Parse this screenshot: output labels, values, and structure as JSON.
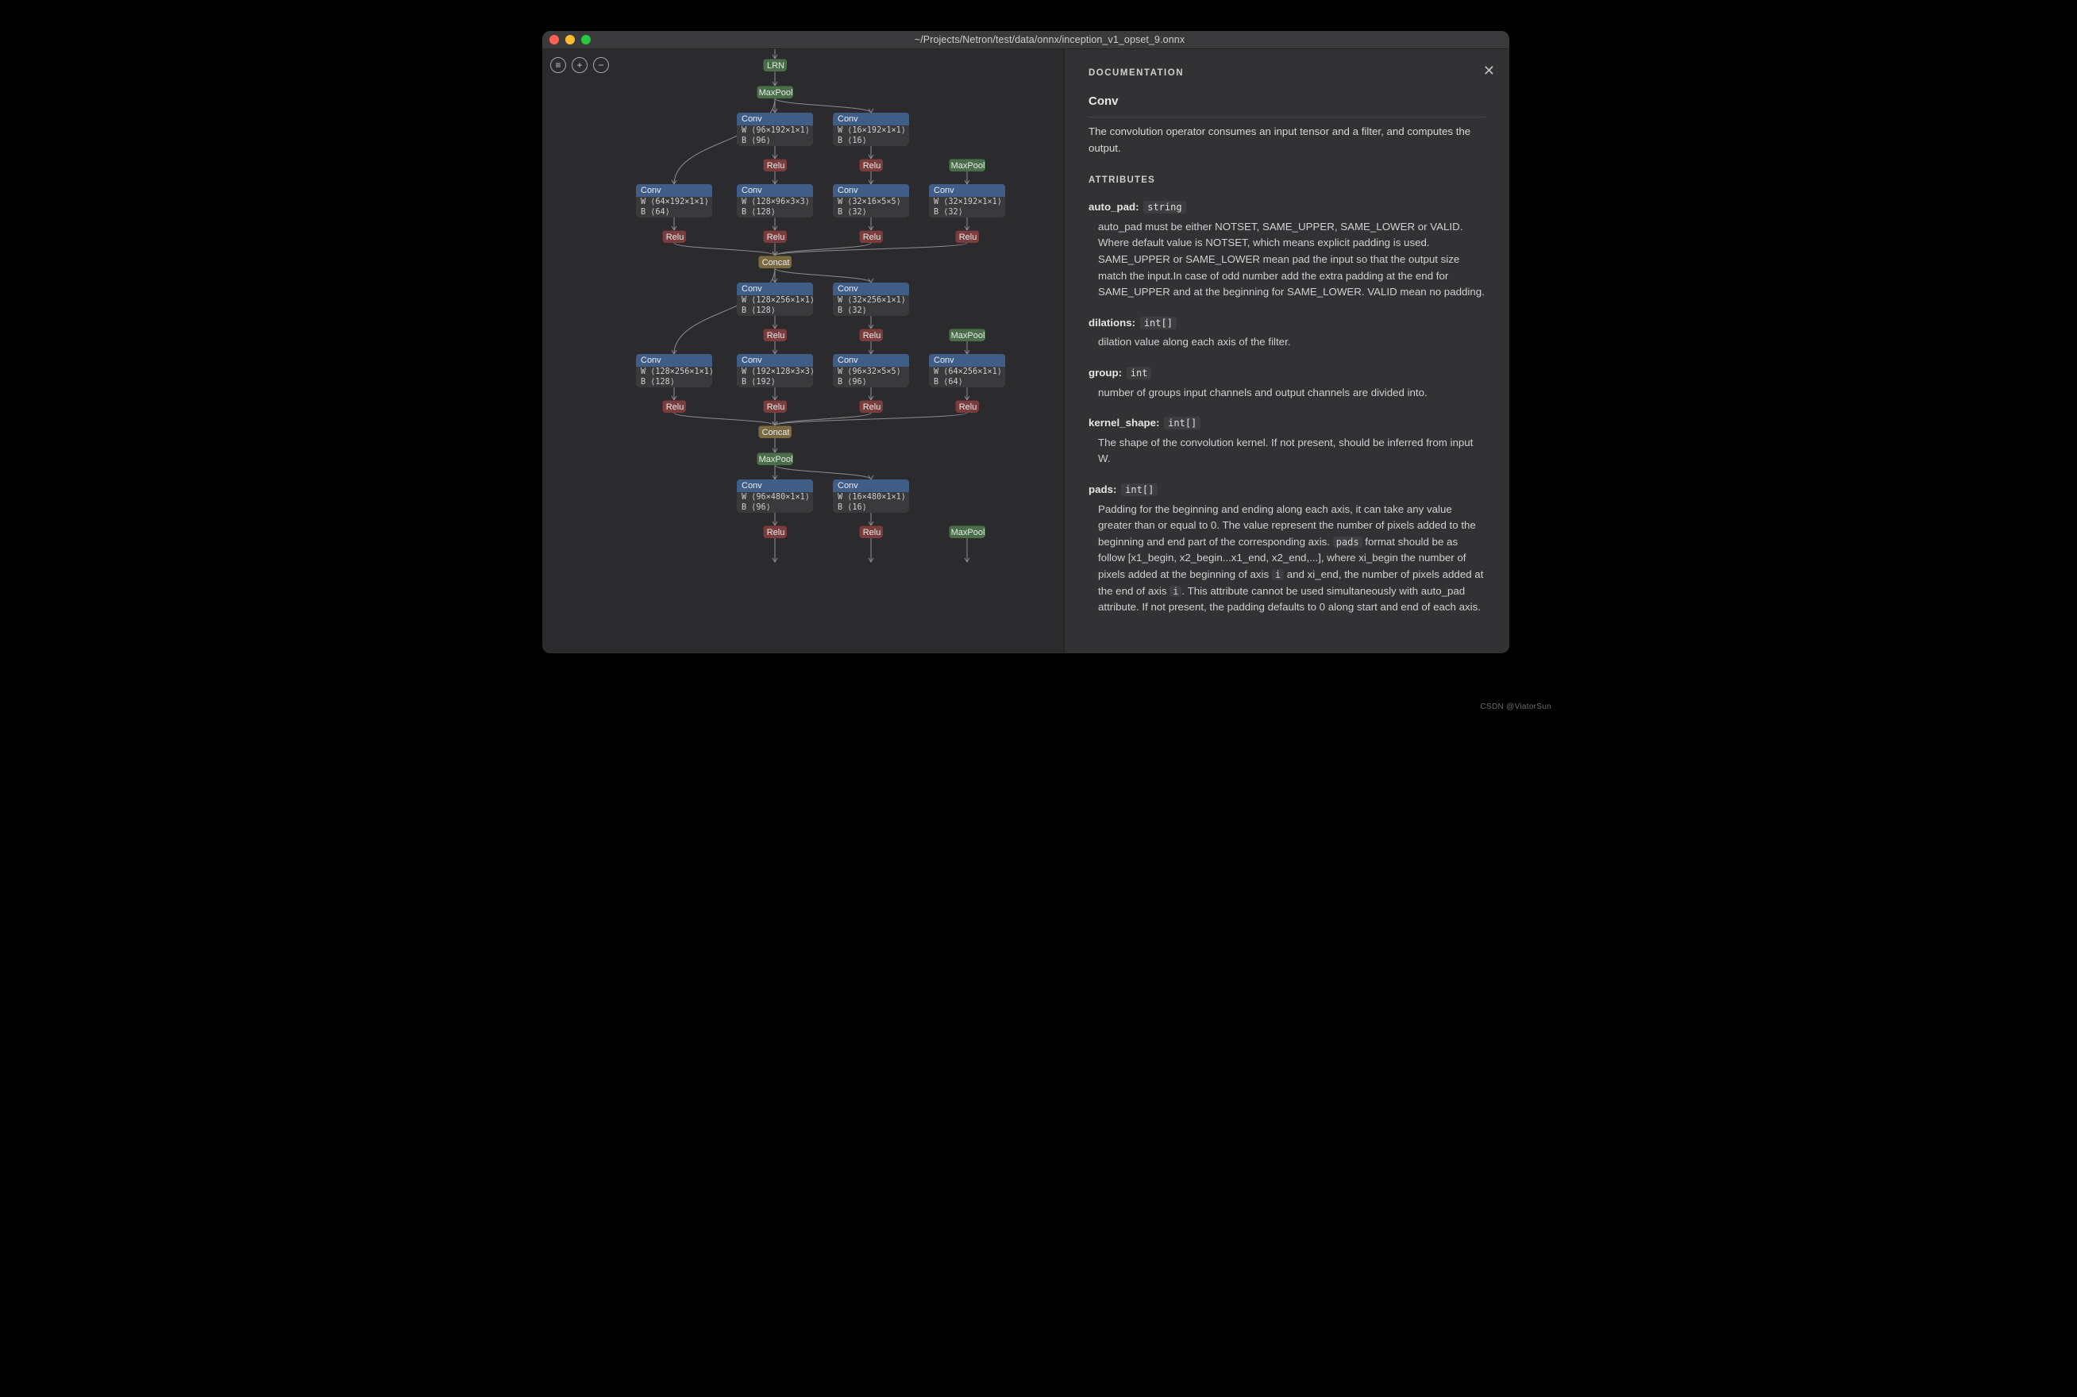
{
  "window": {
    "title": "~/Projects/Netron/test/data/onnx/inception_v1_opset_9.onnx"
  },
  "toolbar": {
    "menu": "≡",
    "zoom_in": "+",
    "zoom_out": "−"
  },
  "labels": {
    "lrn": "LRN",
    "maxpool": "MaxPool",
    "conv": "Conv",
    "relu": "Relu",
    "concat": "Concat"
  },
  "graph": {
    "rows": [
      {
        "kind": "lrn",
        "items": [
          {
            "slot": 1
          }
        ]
      },
      {
        "kind": "maxpool",
        "items": [
          {
            "slot": 1
          }
        ]
      },
      {
        "kind": "conv2",
        "items": [
          {
            "slot": 1,
            "w": "W ⟨96×192×1×1⟩",
            "b": "B ⟨96⟩"
          },
          {
            "slot": 2,
            "w": "W ⟨16×192×1×1⟩",
            "b": "B ⟨16⟩"
          }
        ]
      },
      {
        "kind": "relu2mp",
        "items": [
          {
            "slot": 1
          },
          {
            "slot": 2
          },
          {
            "slot": 4,
            "mp": true
          }
        ]
      },
      {
        "kind": "conv4",
        "items": [
          {
            "slot": 0,
            "w": "W ⟨64×192×1×1⟩",
            "b": "B ⟨64⟩"
          },
          {
            "slot": 1,
            "w": "W ⟨128×96×3×3⟩",
            "b": "B ⟨128⟩"
          },
          {
            "slot": 2,
            "w": "W ⟨32×16×5×5⟩",
            "b": "B ⟨32⟩"
          },
          {
            "slot": 3,
            "w": "W ⟨32×192×1×1⟩",
            "b": "B ⟨32⟩"
          }
        ]
      },
      {
        "kind": "relu4",
        "items": [
          {
            "slot": 0
          },
          {
            "slot": 1
          },
          {
            "slot": 2
          },
          {
            "slot": 3
          }
        ]
      },
      {
        "kind": "concat",
        "items": [
          {
            "slot": 1
          }
        ]
      },
      {
        "kind": "conv2",
        "items": [
          {
            "slot": 1,
            "w": "W ⟨128×256×1×1⟩",
            "b": "B ⟨128⟩"
          },
          {
            "slot": 2,
            "w": "W ⟨32×256×1×1⟩",
            "b": "B ⟨32⟩"
          }
        ]
      },
      {
        "kind": "relu2mp",
        "items": [
          {
            "slot": 1
          },
          {
            "slot": 2
          },
          {
            "slot": 4,
            "mp": true
          }
        ]
      },
      {
        "kind": "conv4",
        "items": [
          {
            "slot": 0,
            "w": "W ⟨128×256×1×1⟩",
            "b": "B ⟨128⟩"
          },
          {
            "slot": 1,
            "w": "W ⟨192×128×3×3⟩",
            "b": "B ⟨192⟩"
          },
          {
            "slot": 2,
            "w": "W ⟨96×32×5×5⟩",
            "b": "B ⟨96⟩"
          },
          {
            "slot": 3,
            "w": "W ⟨64×256×1×1⟩",
            "b": "B ⟨64⟩"
          }
        ]
      },
      {
        "kind": "relu4",
        "items": [
          {
            "slot": 0
          },
          {
            "slot": 1
          },
          {
            "slot": 2
          },
          {
            "slot": 3
          }
        ]
      },
      {
        "kind": "concat",
        "items": [
          {
            "slot": 1
          }
        ]
      },
      {
        "kind": "maxpool",
        "items": [
          {
            "slot": 1
          }
        ]
      },
      {
        "kind": "conv2",
        "items": [
          {
            "slot": 1,
            "w": "W ⟨96×480×1×1⟩",
            "b": "B ⟨96⟩"
          },
          {
            "slot": 2,
            "w": "W ⟨16×480×1×1⟩",
            "b": "B ⟨16⟩"
          }
        ]
      },
      {
        "kind": "relu2mp",
        "items": [
          {
            "slot": 1
          },
          {
            "slot": 2
          },
          {
            "slot": 4,
            "mp": true
          }
        ]
      }
    ]
  },
  "doc": {
    "heading": "DOCUMENTATION",
    "title": "Conv",
    "intro": "The convolution operator consumes an input tensor and a filter, and computes the output.",
    "attr_heading": "ATTRIBUTES",
    "attrs": [
      {
        "name": "auto_pad:",
        "type": "string",
        "desc": "auto_pad must be either NOTSET, SAME_UPPER, SAME_LOWER or VALID. Where default value is NOTSET, which means explicit padding is used. SAME_UPPER or SAME_LOWER mean pad the input so that the output size match the input.In case of odd number add the extra padding at the end for SAME_UPPER and at the beginning for SAME_LOWER. VALID mean no padding."
      },
      {
        "name": "dilations:",
        "type": "int[]",
        "desc": "dilation value along each axis of the filter."
      },
      {
        "name": "group:",
        "type": "int",
        "desc": "number of groups input channels and output channels are divided into."
      },
      {
        "name": "kernel_shape:",
        "type": "int[]",
        "desc": "The shape of the convolution kernel. If not present, should be inferred from input W."
      },
      {
        "name": "pads:",
        "type": "int[]",
        "desc_html": "Padding for the beginning and ending along each axis, it can take any value greater than or equal to 0. The value represent the number of pixels added to the beginning and end part of the corresponding axis. <code class='inline'>pads</code> format should be as follow [x1_begin, x2_begin...x1_end, x2_end,...], where xi_begin the number of pixels added at the beginning of axis <code class='inline'>i</code> and xi_end, the number of pixels added at the end of axis <code class='inline'>i</code>. This attribute cannot be used simultaneously with auto_pad attribute. If not present, the padding defaults to 0 along start and end of each axis."
      }
    ]
  },
  "watermark": "CSDN @ViatorSun"
}
